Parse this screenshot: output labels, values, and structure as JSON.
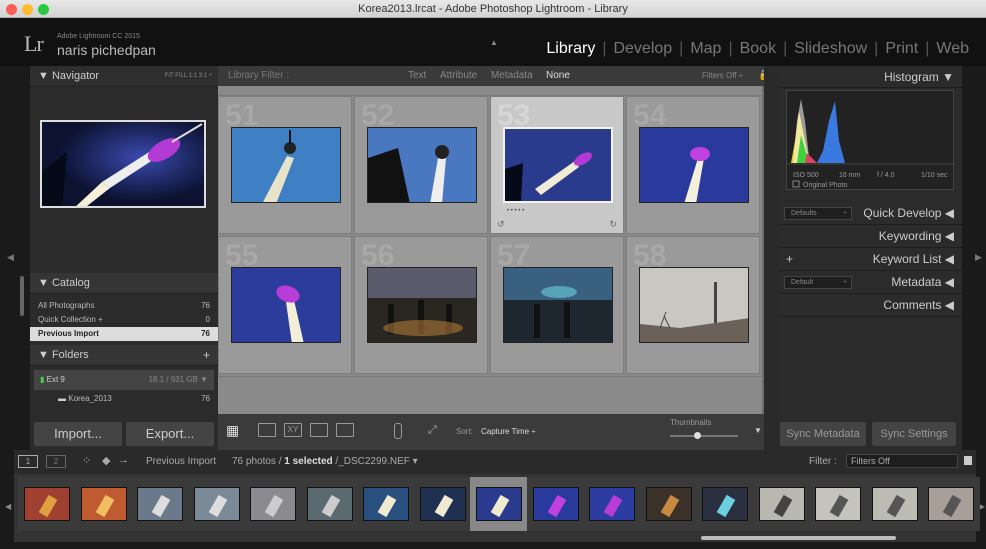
{
  "window": {
    "title": "Korea2013.lrcat - Adobe Photoshop Lightroom - Library"
  },
  "identity": {
    "logo": "Lr",
    "product": "Adobe Lightroom CC 2015",
    "user": "naris pichedpan"
  },
  "modules": [
    "Library",
    "Develop",
    "Map",
    "Book",
    "Slideshow",
    "Print",
    "Web"
  ],
  "navigator": {
    "title": "Navigator",
    "options": "FIT  FILL  1:1  3:1 ÷"
  },
  "catalog": {
    "title": "Catalog",
    "items": [
      {
        "label": "All Photographs",
        "count": "76"
      },
      {
        "label": "Quick Collection +",
        "count": "0"
      },
      {
        "label": "Previous Import",
        "count": "76"
      }
    ]
  },
  "folders": {
    "title": "Folders",
    "add": "+",
    "volume": {
      "name": "Ext 9",
      "size": "18.1 / 931 GB"
    },
    "items": [
      {
        "label": "Korea_2013",
        "count": "76"
      }
    ]
  },
  "buttons": {
    "import": "Import...",
    "export": "Export..."
  },
  "filter": {
    "label": "Library Filter :",
    "tabs": [
      "Text",
      "Attribute",
      "Metadata",
      "None"
    ],
    "status": "Filters Off ÷"
  },
  "grid": {
    "cells": [
      {
        "num": "51"
      },
      {
        "num": "52"
      },
      {
        "num": "53"
      },
      {
        "num": "54"
      },
      {
        "num": "55"
      },
      {
        "num": "56"
      },
      {
        "num": "57"
      },
      {
        "num": "58"
      }
    ],
    "selected_dots": "• • • • •"
  },
  "toolbar": {
    "sort_label": "Sort:",
    "sort_value": "Capture Time ÷",
    "thumbnails_label": "Thumbnails",
    "thumbnail_size": 0.4
  },
  "histogram": {
    "title": "Histogram",
    "iso": "ISO 500",
    "focal": "16 mm",
    "aperture": "f / 4.0",
    "shutter": "1/10 sec",
    "original_label": "Original Photo"
  },
  "right_panels": {
    "quick_develop": {
      "preset": "Defaults",
      "title": "Quick Develop"
    },
    "keywording": "Keywording",
    "keyword_list": {
      "add": "+",
      "title": "Keyword List"
    },
    "metadata": {
      "preset": "Default",
      "title": "Metadata"
    },
    "comments": "Comments"
  },
  "sync": {
    "metadata": "Sync Metadata",
    "settings": "Sync Settings"
  },
  "filmbar": {
    "view1": "1",
    "view2": "2",
    "source": "Previous Import",
    "info": "76 photos / ",
    "selected": "1 selected",
    "file": " /_DSC2299.NEF ▾",
    "filter_label": "Filter :",
    "filter_value": "Filters Off"
  },
  "colors": {
    "accent_blue": "#2a3a8c",
    "select_bg": "#dddddd",
    "traffic_red": "#fc5f57",
    "traffic_yellow": "#fdbc2e",
    "traffic_green": "#28c840"
  },
  "icons": {
    "arrow_up": "▲",
    "disclosure_down": "▼",
    "disclosure_left": "◀",
    "back": "◆",
    "fwd": "→",
    "grid": "▦"
  }
}
